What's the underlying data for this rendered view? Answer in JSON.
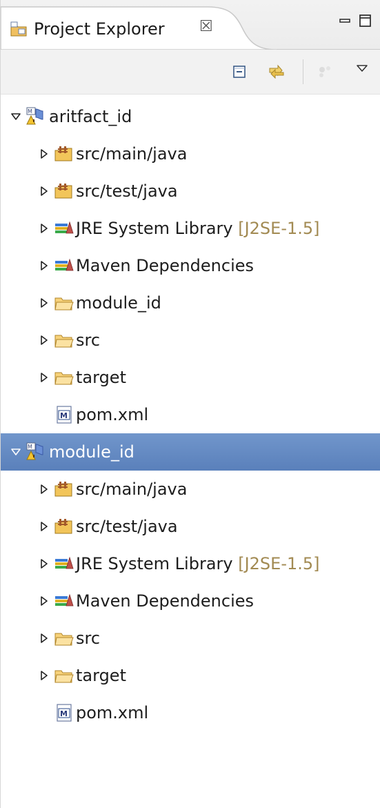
{
  "view": {
    "title": "Project Explorer",
    "close_glyph": "☒"
  },
  "toolbar": {
    "buttons": [
      {
        "name": "collapse-all",
        "icon": "collapse-all-icon"
      },
      {
        "name": "link-with-editor",
        "icon": "link-with-editor-icon"
      },
      {
        "name": "focus",
        "icon": "focus-icon",
        "enabled": false
      },
      {
        "name": "view-menu",
        "icon": "chevron-down-icon"
      }
    ]
  },
  "tree": {
    "projects": [
      {
        "label": "aritfact_id",
        "expanded": true,
        "selected": false,
        "children": [
          {
            "label": "src/main/java",
            "type": "source-folder",
            "expandable": true
          },
          {
            "label": "src/test/java",
            "type": "source-folder",
            "expandable": true
          },
          {
            "label": "JRE System Library",
            "decoration": "[J2SE-1.5]",
            "type": "library",
            "expandable": true
          },
          {
            "label": "Maven Dependencies",
            "type": "library",
            "expandable": true
          },
          {
            "label": "module_id",
            "type": "folder",
            "expandable": true
          },
          {
            "label": "src",
            "type": "folder",
            "expandable": true
          },
          {
            "label": "target",
            "type": "folder",
            "expandable": true
          },
          {
            "label": "pom.xml",
            "type": "pom-file",
            "expandable": false
          }
        ]
      },
      {
        "label": "module_id",
        "expanded": true,
        "selected": true,
        "children": [
          {
            "label": "src/main/java",
            "type": "source-folder",
            "expandable": true
          },
          {
            "label": "src/test/java",
            "type": "source-folder",
            "expandable": true
          },
          {
            "label": "JRE System Library",
            "decoration": "[J2SE-1.5]",
            "type": "library",
            "expandable": true
          },
          {
            "label": "Maven Dependencies",
            "type": "library",
            "expandable": true
          },
          {
            "label": "src",
            "type": "folder",
            "expandable": true
          },
          {
            "label": "target",
            "type": "folder",
            "expandable": true
          },
          {
            "label": "pom.xml",
            "type": "pom-file",
            "expandable": false
          }
        ]
      }
    ]
  },
  "colors": {
    "selection": "#6a8fc6",
    "decoration": "#a28a52",
    "folder": "#e8b04a"
  }
}
